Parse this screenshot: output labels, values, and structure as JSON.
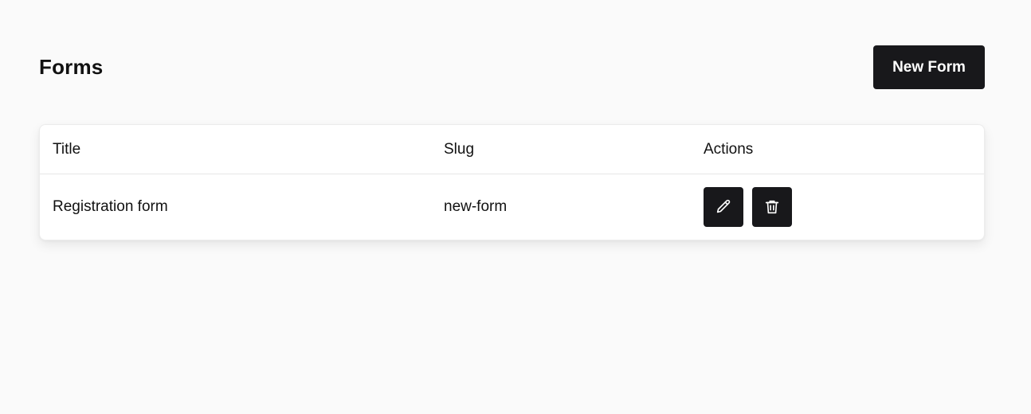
{
  "header": {
    "title": "Forms",
    "new_button_label": "New Form"
  },
  "table": {
    "columns": [
      "Title",
      "Slug",
      "Actions"
    ],
    "rows": [
      {
        "title": "Registration form",
        "slug": "new-form",
        "actions": [
          "pencil-icon",
          "trash-icon"
        ]
      }
    ]
  },
  "colors": {
    "background": "#fafafa",
    "button": "#18181b",
    "button_text": "#ffffff"
  }
}
